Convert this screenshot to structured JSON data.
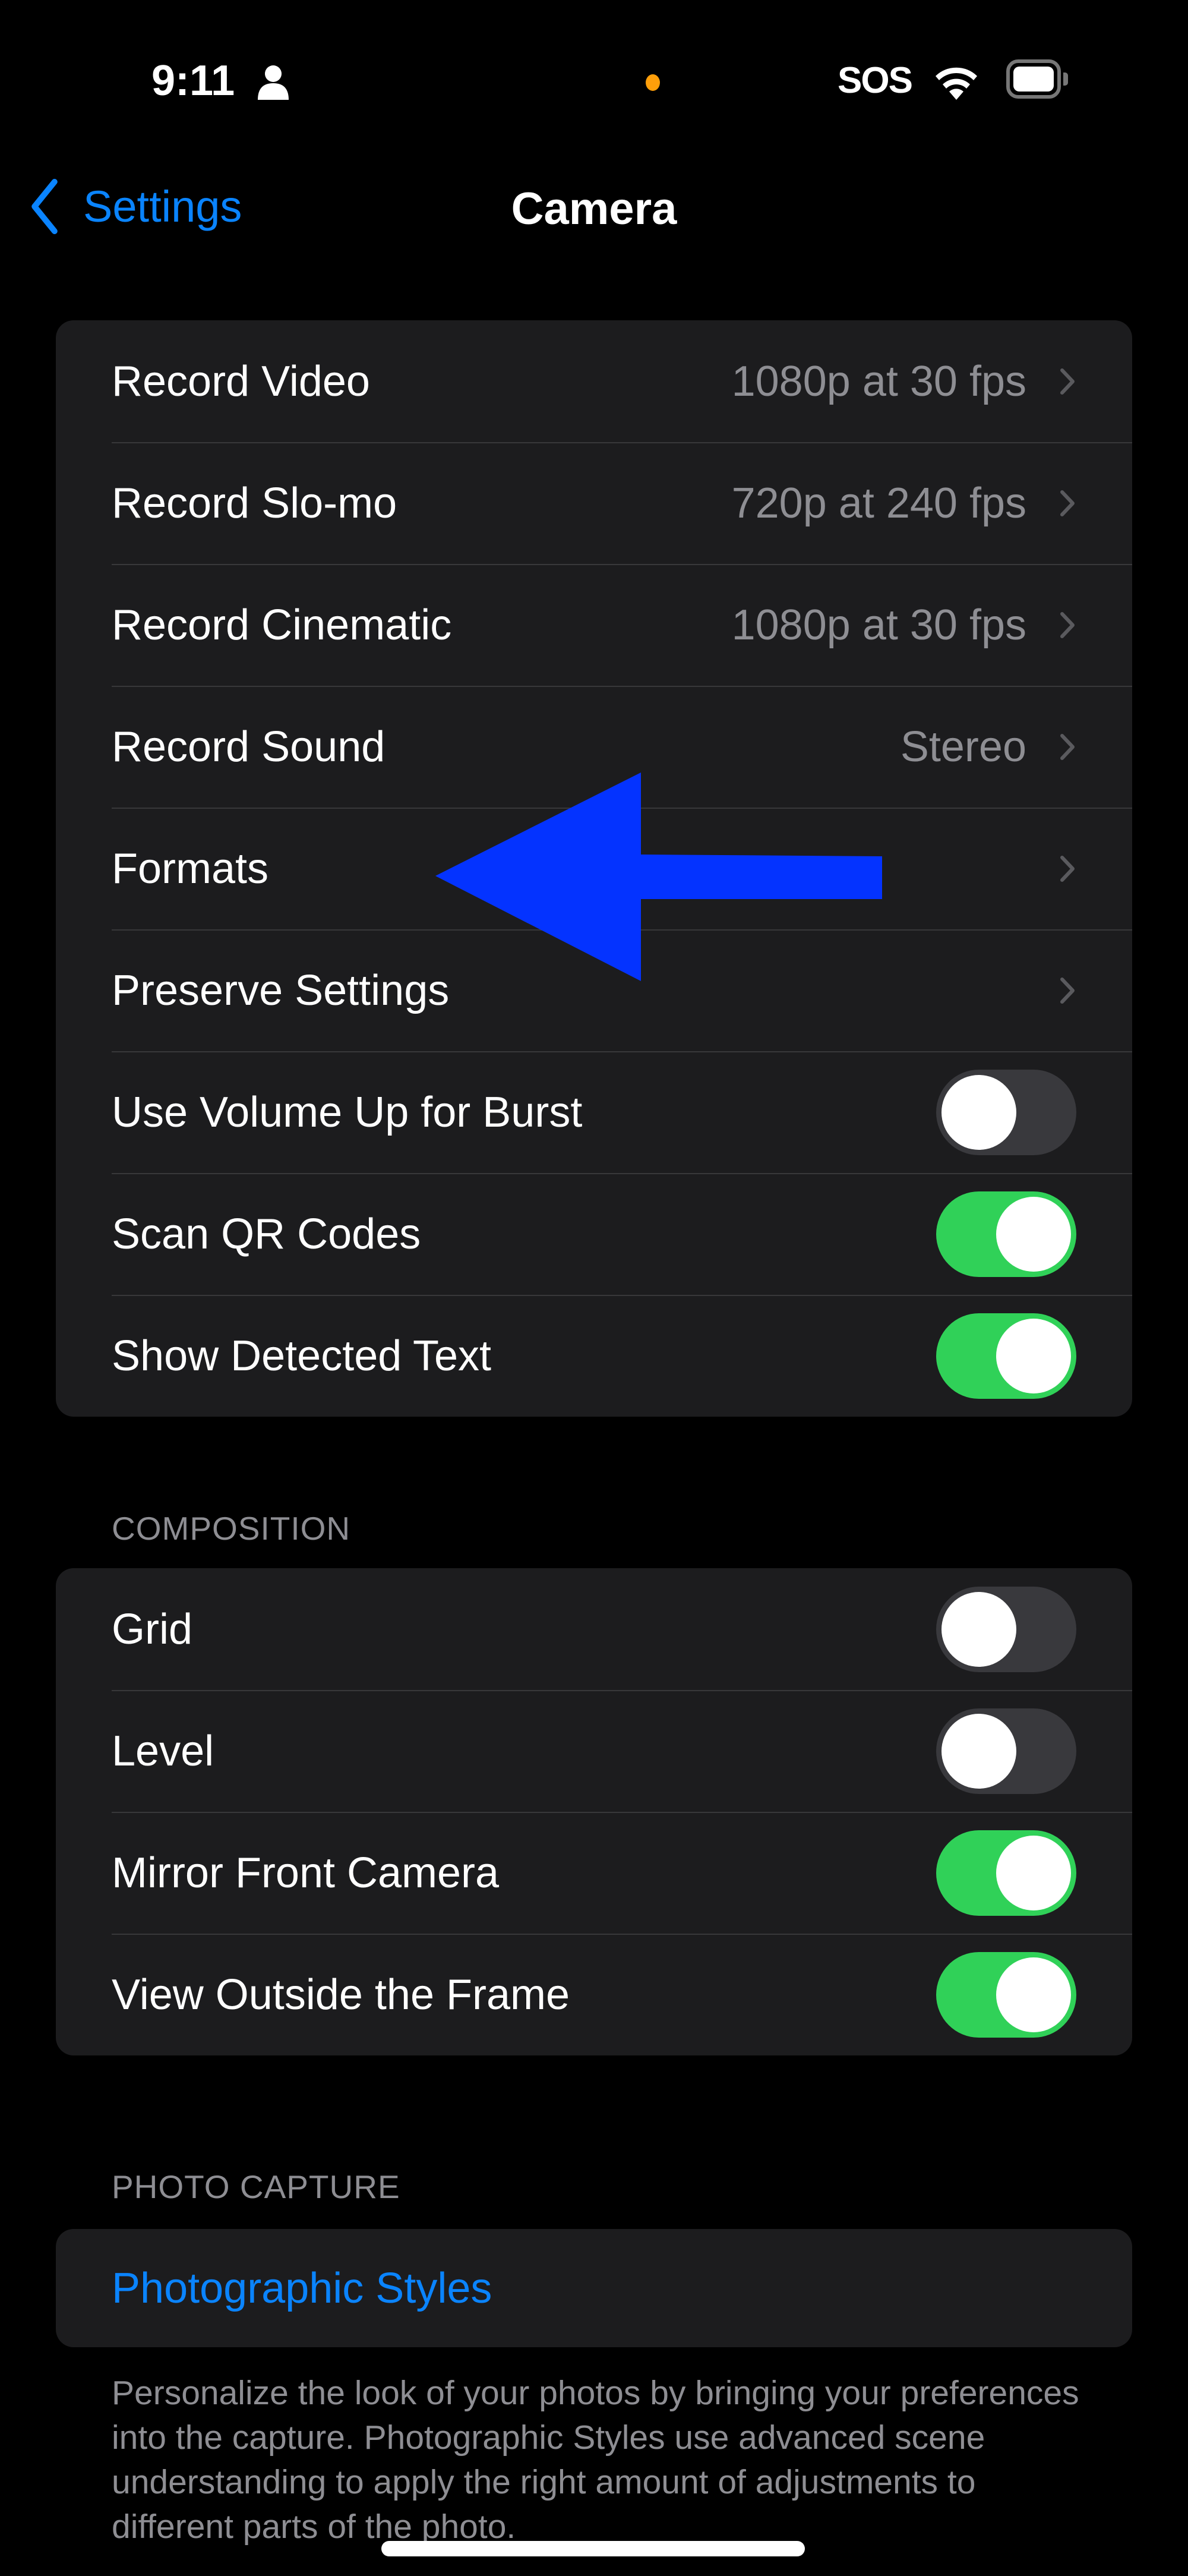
{
  "status_bar": {
    "time": "9:11",
    "carrier": "SOS",
    "privacy_indicator_color": "#ff9f0a",
    "icons": [
      "person-icon",
      "wifi-icon",
      "battery-icon"
    ]
  },
  "nav": {
    "back_label": "Settings",
    "title": "Camera"
  },
  "groups": [
    {
      "header": "",
      "rows": [
        {
          "label": "Record Video",
          "value": "1080p at 30 fps",
          "type": "disclosure"
        },
        {
          "label": "Record Slo-mo",
          "value": "720p at 240 fps",
          "type": "disclosure"
        },
        {
          "label": "Record Cinematic",
          "value": "1080p at 30 fps",
          "type": "disclosure"
        },
        {
          "label": "Record Sound",
          "value": "Stereo",
          "type": "disclosure"
        },
        {
          "label": "Formats",
          "value": "",
          "type": "disclosure"
        },
        {
          "label": "Preserve Settings",
          "value": "",
          "type": "disclosure"
        },
        {
          "label": "Use Volume Up for Burst",
          "type": "toggle",
          "on": false
        },
        {
          "label": "Scan QR Codes",
          "type": "toggle",
          "on": true
        },
        {
          "label": "Show Detected Text",
          "type": "toggle",
          "on": true
        }
      ]
    },
    {
      "header": "COMPOSITION",
      "rows": [
        {
          "label": "Grid",
          "type": "toggle",
          "on": false
        },
        {
          "label": "Level",
          "type": "toggle",
          "on": false
        },
        {
          "label": "Mirror Front Camera",
          "type": "toggle",
          "on": true
        },
        {
          "label": "View Outside the Frame",
          "type": "toggle",
          "on": true
        }
      ]
    },
    {
      "header": "PHOTO CAPTURE",
      "rows": [
        {
          "label": "Photographic Styles",
          "type": "link"
        }
      ]
    }
  ],
  "footer_text": "Personalize the look of your photos by bringing your preferences into the capture. Photographic Styles use advanced scene understanding to apply the right amount of adjustments to different parts of the photo.",
  "annotation": {
    "type": "arrow",
    "points_to": "Formats",
    "color": "#0433ff"
  },
  "colors": {
    "accent": "#0a84ff",
    "toggle_on": "#30d158",
    "toggle_off": "#39393d",
    "cell_bg": "#1c1c1e"
  }
}
